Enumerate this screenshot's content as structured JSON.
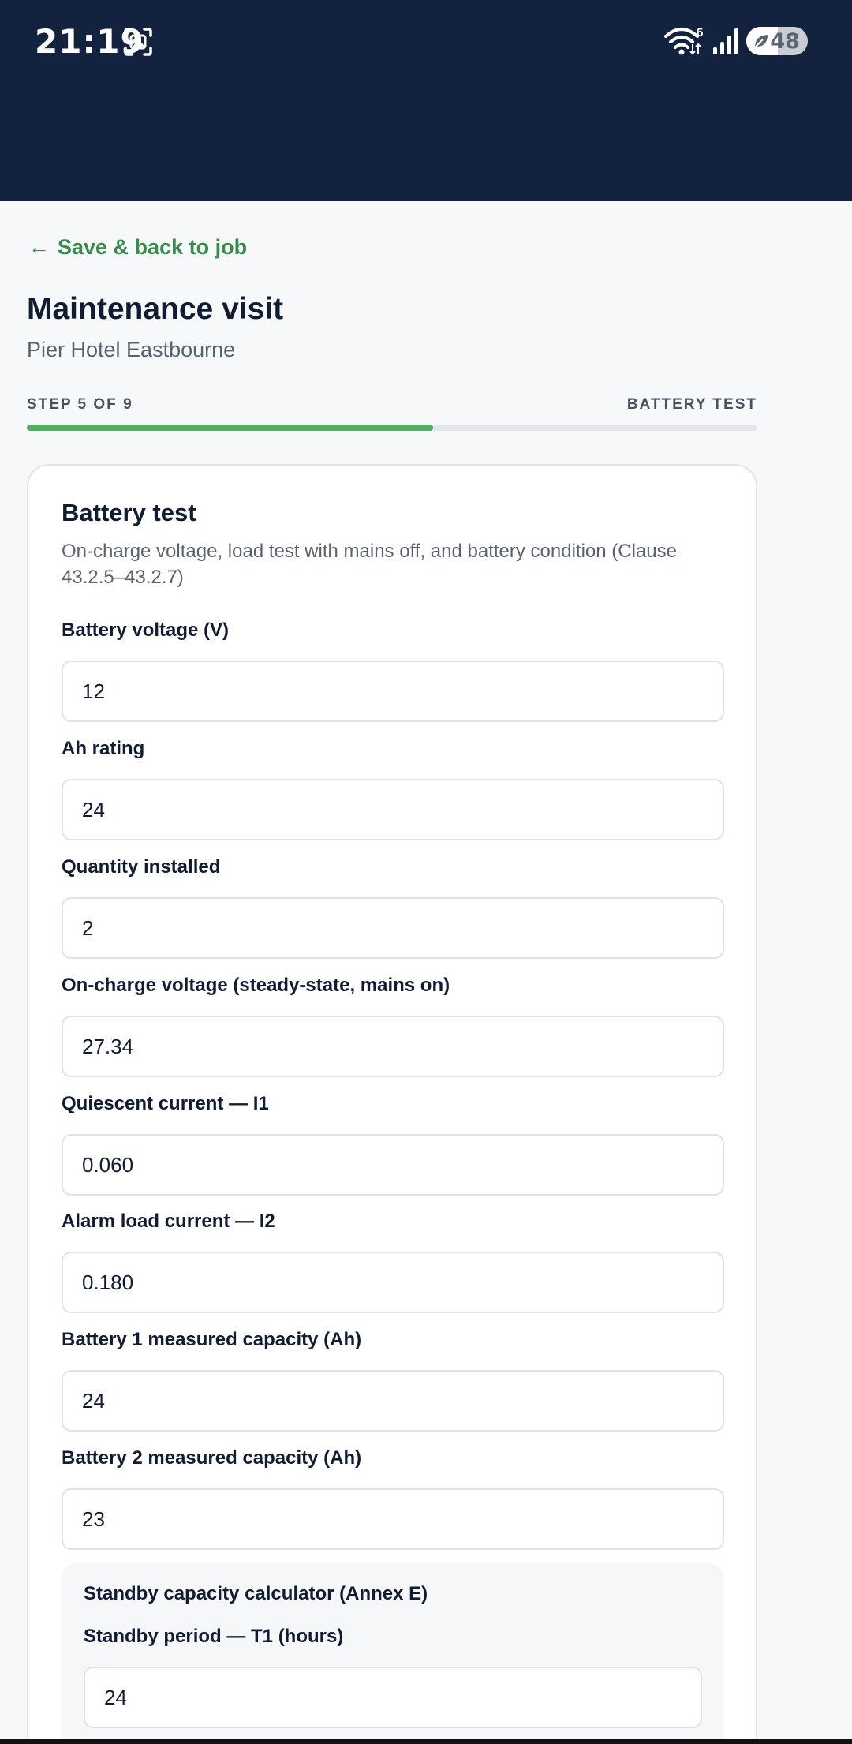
{
  "status_bar": {
    "time": "21:19",
    "battery_level": "48",
    "wifi_badge": "6",
    "icons": [
      "screenshot-icon",
      "wifi-icon",
      "signal-icon",
      "battery-icon"
    ]
  },
  "nav": {
    "back_arrow": "←",
    "back_label": "Save & back to job"
  },
  "header": {
    "title": "Maintenance visit",
    "subtitle": "Pier Hotel Eastbourne"
  },
  "progress": {
    "step_label": "STEP 5 OF 9",
    "step_name": "BATTERY TEST",
    "fraction": 0.556,
    "color": "#4caf62"
  },
  "card": {
    "title": "Battery test",
    "description": "On-charge voltage, load test with mains off, and battery condition (Clause 43.2.5–43.2.7)",
    "fields": [
      {
        "label": "Battery voltage (V)",
        "value": "12"
      },
      {
        "label": "Ah rating",
        "value": "24"
      },
      {
        "label": "Quantity installed",
        "value": "2"
      },
      {
        "label": "On-charge voltage (steady-state, mains on)",
        "value": "27.34"
      },
      {
        "label": "Quiescent current — I1",
        "value": "0.060"
      },
      {
        "label": "Alarm load current — I2",
        "value": "0.180"
      },
      {
        "label": "Battery 1 measured capacity (Ah)",
        "value": "24"
      },
      {
        "label": "Battery 2 measured capacity (Ah)",
        "value": "23"
      }
    ],
    "calculator": {
      "title": "Standby capacity calculator (Annex E)",
      "field_label": "Standby period — T1 (hours)",
      "field_value": "24"
    }
  },
  "colors": {
    "header_bg": "#13223f",
    "accent_green": "#3a8a4d",
    "page_bg": "#f6f8fa"
  }
}
